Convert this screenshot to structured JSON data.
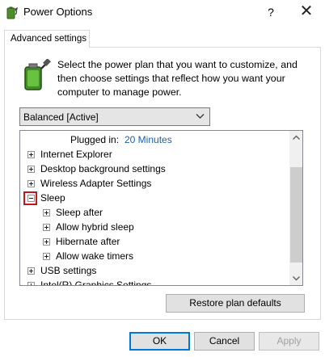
{
  "window": {
    "title": "Power Options",
    "help_glyph": "?",
    "close_glyph": "✕"
  },
  "tab": {
    "label": "Advanced settings"
  },
  "description": "Select the power plan that you want to customize, and then choose settings that reflect how you want your computer to manage power.",
  "plan_dropdown": {
    "selected": "Balanced [Active]"
  },
  "tree": {
    "plugged_in_label": "Plugged in:",
    "plugged_in_value": "20 Minutes",
    "items": [
      {
        "label": "Internet Explorer",
        "expanded": false
      },
      {
        "label": "Desktop background settings",
        "expanded": false
      },
      {
        "label": "Wireless Adapter Settings",
        "expanded": false
      },
      {
        "label": "Sleep",
        "expanded": true
      },
      {
        "label": "Sleep after",
        "expanded": false
      },
      {
        "label": "Allow hybrid sleep",
        "expanded": false
      },
      {
        "label": "Hibernate after",
        "expanded": false
      },
      {
        "label": "Allow wake timers",
        "expanded": false
      },
      {
        "label": "USB settings",
        "expanded": false
      },
      {
        "label": "Intel(R) Graphics Settings",
        "expanded": false
      }
    ],
    "highlight_color": "#c4161c"
  },
  "buttons": {
    "restore": "Restore plan defaults",
    "ok": "OK",
    "cancel": "Cancel",
    "apply": "Apply"
  },
  "icons": {
    "app": "power-options-icon",
    "battery": "battery-plug-icon"
  },
  "colors": {
    "accent": "#0078d7",
    "link_value": "#1a5fb4"
  }
}
